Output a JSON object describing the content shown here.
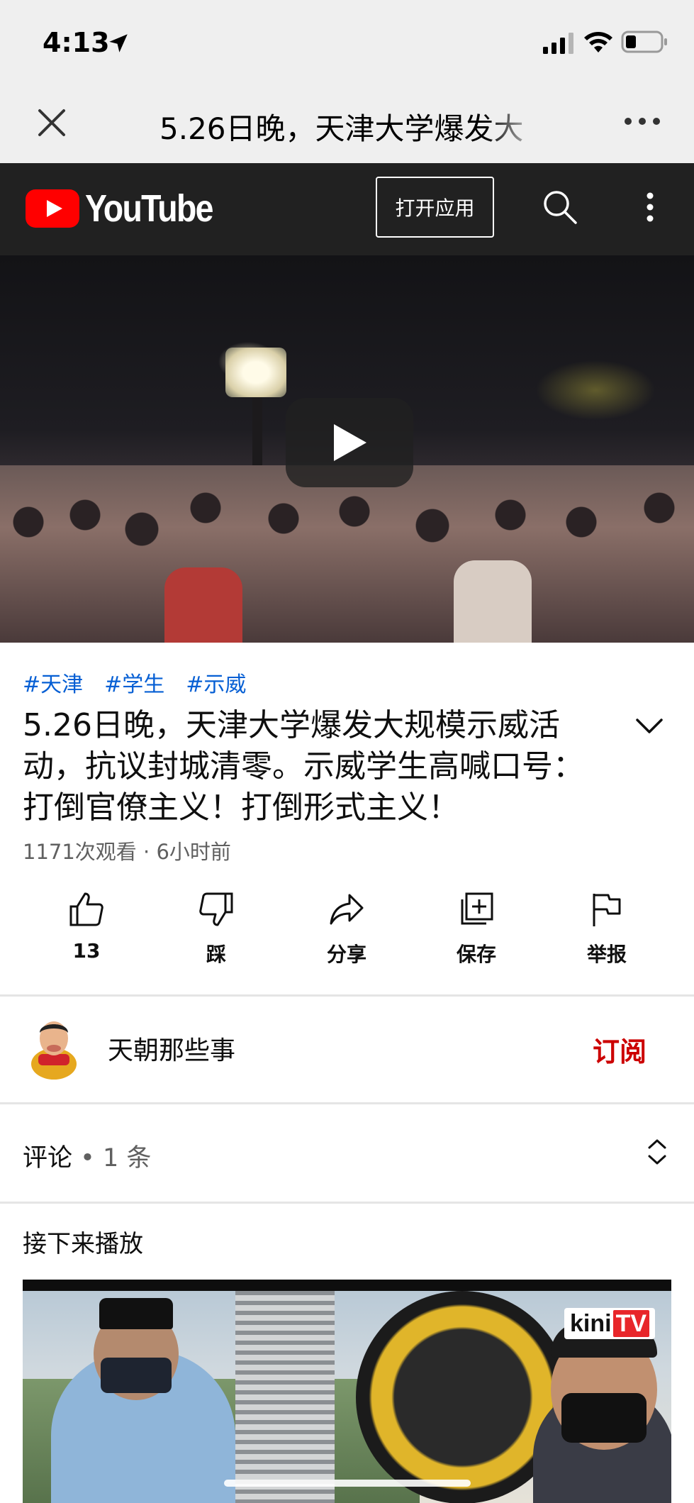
{
  "status_bar": {
    "time": "4:13"
  },
  "browser": {
    "title": "5.26日晚，天津大学爆发大"
  },
  "youtube": {
    "logo_text": "YouTube",
    "open_app_label": "打开应用",
    "brand_red": "#ff0000"
  },
  "video": {
    "hashtags": [
      "#天津",
      "#学生",
      "#示威"
    ],
    "title": "5.26日晚，天津大学爆发大规模示威活动，抗议封城清零。示威学生高喊口号：打倒官僚主义！打倒形式主义！",
    "meta": "1171次观看 · 6小时前"
  },
  "actions": {
    "like": {
      "label": "13",
      "icon": "thumbs-up-icon"
    },
    "dislike": {
      "label": "踩",
      "icon": "thumbs-down-icon"
    },
    "share": {
      "label": "分享",
      "icon": "share-icon"
    },
    "save": {
      "label": "保存",
      "icon": "add-to-playlist-icon"
    },
    "report": {
      "label": "举报",
      "icon": "flag-icon"
    }
  },
  "channel": {
    "name": "天朝那些事",
    "subscribe_label": "订阅",
    "subscribe_color": "#cc0000"
  },
  "comments": {
    "label": "评论",
    "separator": "•",
    "count": "1 条"
  },
  "up_next": {
    "label": "接下来播放",
    "thumbnail_logo": "kini",
    "thumbnail_logo_suffix": "TV"
  },
  "link_color": "#065fd4"
}
